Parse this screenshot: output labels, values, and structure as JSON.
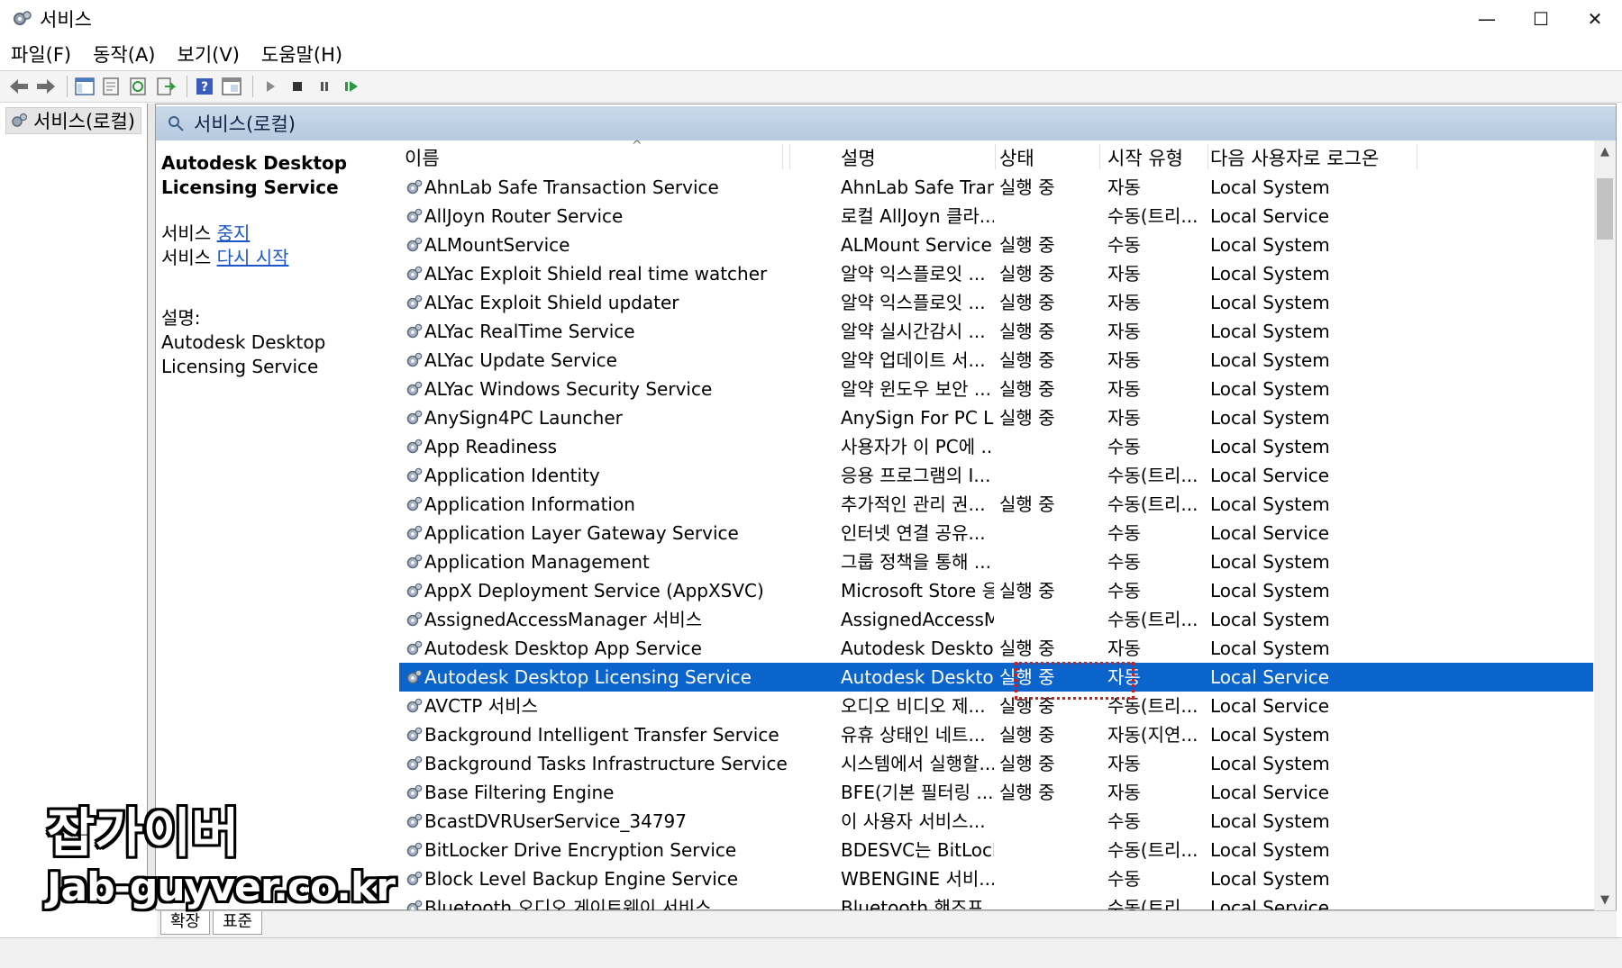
{
  "window": {
    "title": "서비스",
    "minimize": "—",
    "maximize": "☐",
    "close": "✕"
  },
  "menu": [
    "파일(F)",
    "동작(A)",
    "보기(V)",
    "도움말(H)"
  ],
  "tree": {
    "root_label": "서비스(로컬)"
  },
  "pane": {
    "header_title": "서비스(로컬)"
  },
  "details": {
    "service_title": "Autodesk Desktop Licensing Service",
    "stop_prefix": "서비스 ",
    "stop_link": "중지",
    "restart_prefix": "서비스 ",
    "restart_link": "다시 시작",
    "desc_label": "설명:",
    "desc_text": "Autodesk Desktop Licensing Service"
  },
  "columns": {
    "name": "이름",
    "desc": "설명",
    "status": "상태",
    "type": "시작 유형",
    "logon": "다음 사용자로 로그온"
  },
  "rows": [
    {
      "name": "AhnLab Safe Transaction Service",
      "desc": "AhnLab Safe Tran...",
      "status": "실행 중",
      "type": "자동",
      "logon": "Local System"
    },
    {
      "name": "AllJoyn Router Service",
      "desc": "로컬 AllJoyn 클라...",
      "status": "",
      "type": "수동(트리...",
      "logon": "Local Service"
    },
    {
      "name": "ALMountService",
      "desc": "ALMount Service",
      "status": "실행 중",
      "type": "수동",
      "logon": "Local System"
    },
    {
      "name": "ALYac Exploit Shield real time watcher",
      "desc": "알약 익스플로잇 ...",
      "status": "실행 중",
      "type": "자동",
      "logon": "Local System"
    },
    {
      "name": "ALYac Exploit Shield updater",
      "desc": "알약 익스플로잇 ...",
      "status": "실행 중",
      "type": "자동",
      "logon": "Local System"
    },
    {
      "name": "ALYac RealTime Service",
      "desc": "알약 실시간감시 ...",
      "status": "실행 중",
      "type": "자동",
      "logon": "Local System"
    },
    {
      "name": "ALYac Update Service",
      "desc": "알약 업데이트 서...",
      "status": "실행 중",
      "type": "자동",
      "logon": "Local System"
    },
    {
      "name": "ALYac Windows Security Service",
      "desc": "알약 윈도우 보안 ...",
      "status": "실행 중",
      "type": "자동",
      "logon": "Local System"
    },
    {
      "name": "AnySign4PC Launcher",
      "desc": "AnySign For PC L...",
      "status": "실행 중",
      "type": "자동",
      "logon": "Local System"
    },
    {
      "name": "App Readiness",
      "desc": "사용자가 이 PC에 ...",
      "status": "",
      "type": "수동",
      "logon": "Local System"
    },
    {
      "name": "Application Identity",
      "desc": "응용 프로그램의 I...",
      "status": "",
      "type": "수동(트리...",
      "logon": "Local Service"
    },
    {
      "name": "Application Information",
      "desc": "추가적인 관리 권...",
      "status": "실행 중",
      "type": "수동(트리...",
      "logon": "Local System"
    },
    {
      "name": "Application Layer Gateway Service",
      "desc": "인터넷 연결 공유...",
      "status": "",
      "type": "수동",
      "logon": "Local Service"
    },
    {
      "name": "Application Management",
      "desc": "그룹 정책을 통해 ...",
      "status": "",
      "type": "수동",
      "logon": "Local System"
    },
    {
      "name": "AppX Deployment Service (AppXSVC)",
      "desc": "Microsoft Store 응...",
      "status": "실행 중",
      "type": "수동",
      "logon": "Local System"
    },
    {
      "name": "AssignedAccessManager 서비스",
      "desc": "AssignedAccessM...",
      "status": "",
      "type": "수동(트리...",
      "logon": "Local System"
    },
    {
      "name": "Autodesk Desktop App Service",
      "desc": "Autodesk Desktop...",
      "status": "실행 중",
      "type": "자동",
      "logon": "Local System"
    },
    {
      "name": "Autodesk Desktop Licensing Service",
      "desc": "Autodesk Desktop...",
      "status": "실행 중",
      "type": "자동",
      "logon": "Local Service",
      "selected": true
    },
    {
      "name": "AVCTP 서비스",
      "desc": "오디오 비디오 제...",
      "status": "실행 중",
      "type": "수동(트리...",
      "logon": "Local Service"
    },
    {
      "name": "Background Intelligent Transfer Service",
      "desc": "유휴 상태인 네트...",
      "status": "실행 중",
      "type": "자동(지연...",
      "logon": "Local System"
    },
    {
      "name": "Background Tasks Infrastructure Service",
      "desc": "시스템에서 실행할...",
      "status": "실행 중",
      "type": "자동",
      "logon": "Local System"
    },
    {
      "name": "Base Filtering Engine",
      "desc": "BFE(기본 필터링 ...",
      "status": "실행 중",
      "type": "자동",
      "logon": "Local Service"
    },
    {
      "name": "BcastDVRUserService_34797",
      "desc": "이 사용자 서비스...",
      "status": "",
      "type": "수동",
      "logon": "Local System"
    },
    {
      "name": "BitLocker Drive Encryption Service",
      "desc": "BDESVC는 BitLock...",
      "status": "",
      "type": "수동(트리...",
      "logon": "Local System"
    },
    {
      "name": "Block Level Backup Engine Service",
      "desc": "WBENGINE 서비...",
      "status": "",
      "type": "수동",
      "logon": "Local System"
    },
    {
      "name": "Bluetooth 오디오 게이트웨이 서비스",
      "desc": "Bluetooth 핸즈프...",
      "status": "",
      "type": "수동(트리...",
      "logon": "Local Service"
    }
  ],
  "tabs": [
    "확장",
    "표준"
  ],
  "watermark": {
    "line1": "잡가이버",
    "line2": "Jab-guyver.co.kr"
  }
}
